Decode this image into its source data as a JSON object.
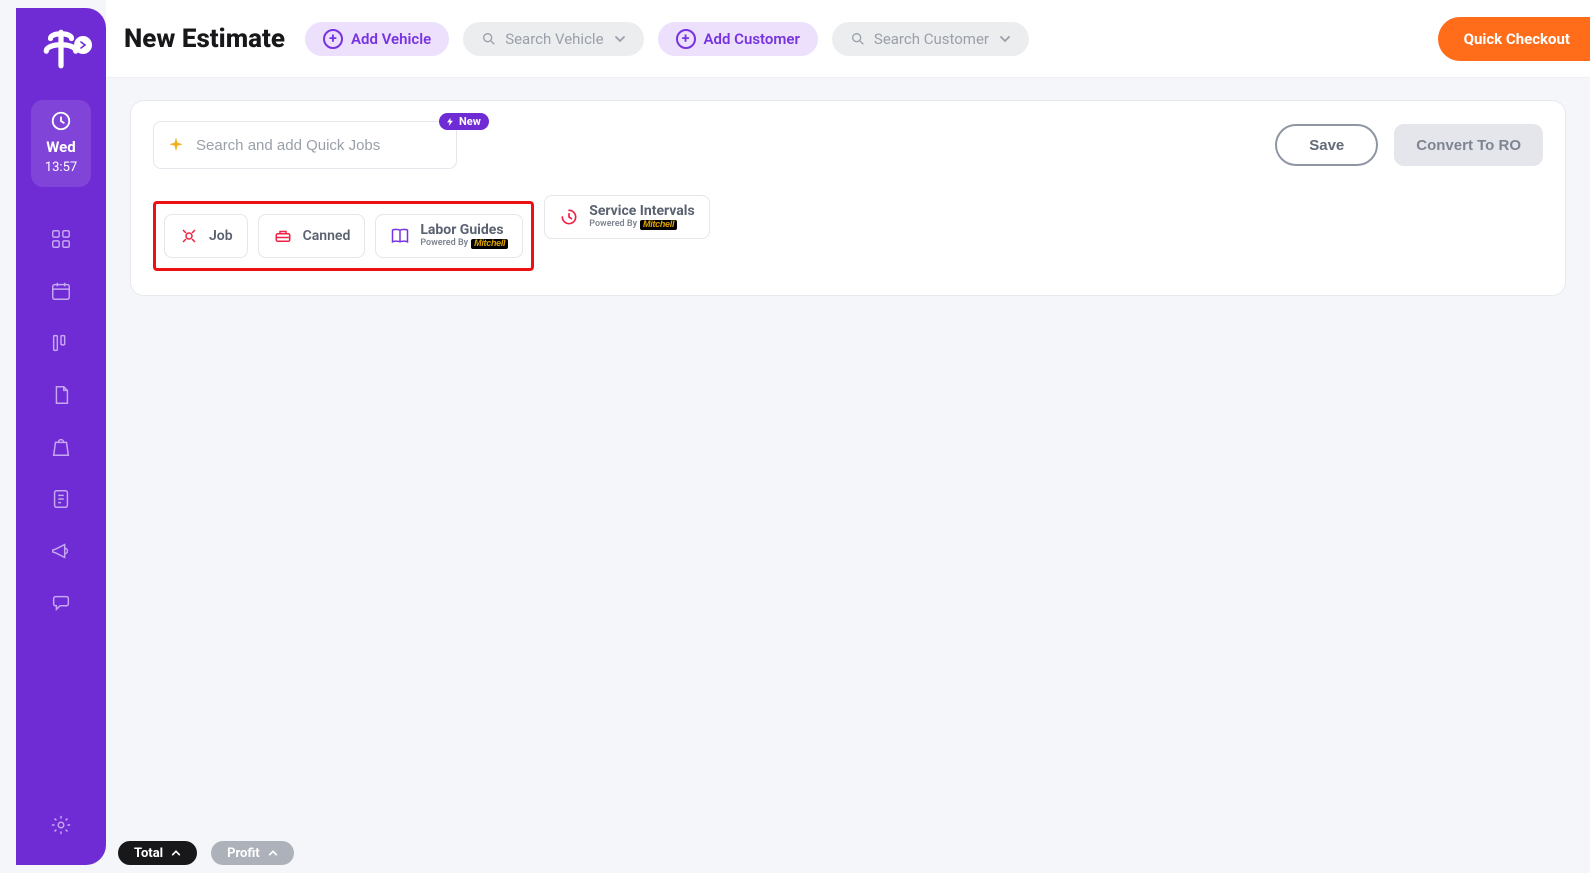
{
  "sidebar": {
    "logo_alt": "app-logo",
    "clock": {
      "day": "Wed",
      "time": "13:57"
    },
    "items": [
      {
        "name": "dashboard-icon"
      },
      {
        "name": "calendar-icon"
      },
      {
        "name": "board-icon"
      },
      {
        "name": "document-icon"
      },
      {
        "name": "bag-icon"
      },
      {
        "name": "report-icon"
      },
      {
        "name": "megaphone-icon"
      },
      {
        "name": "chat-icon"
      }
    ],
    "settings_name": "settings-icon"
  },
  "topbar": {
    "title": "New Estimate",
    "add_vehicle_label": "Add Vehicle",
    "search_vehicle_placeholder": "Search Vehicle",
    "add_customer_label": "Add Customer",
    "search_customer_placeholder": "Search Customer",
    "quick_checkout_label": "Quick Checkout"
  },
  "quick_jobs": {
    "placeholder": "Search and add Quick Jobs",
    "new_badge": "New"
  },
  "actions": {
    "save_label": "Save",
    "convert_label": "Convert To RO"
  },
  "chips": {
    "job": "Job",
    "canned": "Canned",
    "labor_guides": {
      "title": "Labor Guides",
      "powered_by": "Powered By",
      "brand": "Mitchell"
    },
    "service_intervals": {
      "title": "Service Intervals",
      "powered_by": "Powered By",
      "brand": "Mitchell"
    }
  },
  "bottom": {
    "total_label": "Total",
    "profit_label": "Profit"
  }
}
